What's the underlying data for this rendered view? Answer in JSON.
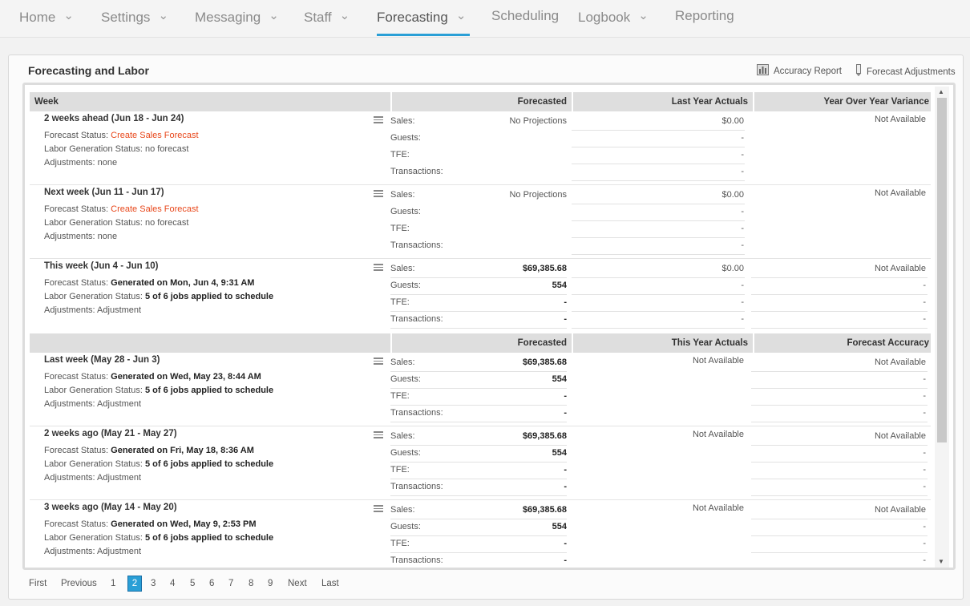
{
  "nav": {
    "items": [
      {
        "label": "Home",
        "chevron": true
      },
      {
        "label": "Settings",
        "chevron": true
      },
      {
        "label": "Messaging",
        "chevron": true
      },
      {
        "label": "Staff",
        "chevron": true
      },
      {
        "label": "Forecasting",
        "chevron": true,
        "active": true
      },
      {
        "label": "Scheduling",
        "chevron": false
      },
      {
        "label": "Logbook",
        "chevron": true
      },
      {
        "label": "Reporting",
        "chevron": false
      }
    ],
    "accent_color": "#2a9fd6"
  },
  "panel": {
    "title": "Forecasting and Labor",
    "accuracy_report": "Accuracy Report",
    "forecast_adjustments": "Forecast Adjustments"
  },
  "future_header": {
    "week": "Week",
    "forecasted": "Forecasted",
    "last_year_actuals": "Last Year Actuals",
    "yoy_variance": "Year Over Year Variance"
  },
  "past_header": {
    "forecasted": "Forecasted",
    "this_year_actuals": "This Year Actuals",
    "forecast_accuracy": "Forecast Accuracy"
  },
  "labels": {
    "forecast_status": "Forecast Status: ",
    "labor_status": "Labor Generation Status: ",
    "adjustments": "Adjustments: ",
    "sales": "Sales:",
    "guests": "Guests:",
    "tfe": "TFE:",
    "transactions": "Transactions:"
  },
  "weeks": [
    {
      "title": "2 weeks ahead (Jun 18 - Jun 24)",
      "forecast_status": "Create Sales Forecast",
      "forecast_link": true,
      "labor_status": "no forecast",
      "labor_bold": false,
      "adjustments": "none",
      "forecasted": [
        "No Projections",
        "",
        "",
        ""
      ],
      "forecasted_bold": false,
      "col3": [
        "$0.00",
        "-",
        "-",
        "-"
      ],
      "col4": [
        "Not Available"
      ]
    },
    {
      "title": "Next week (Jun 11 - Jun 17)",
      "forecast_status": "Create Sales Forecast",
      "forecast_link": true,
      "labor_status": "no forecast",
      "labor_bold": false,
      "adjustments": "none",
      "forecasted": [
        "No Projections",
        "",
        "",
        ""
      ],
      "forecasted_bold": false,
      "col3": [
        "$0.00",
        "-",
        "-",
        "-"
      ],
      "col4": [
        "Not Available"
      ]
    },
    {
      "title": "This week (Jun 4 - Jun 10)",
      "forecast_status": "Generated on Mon, Jun 4, 9:31 AM",
      "forecast_link": false,
      "labor_status": "5 of 6 jobs applied to schedule",
      "labor_bold": true,
      "adjustments": "Adjustment",
      "forecasted": [
        "$69,385.68",
        "554",
        "-",
        "-"
      ],
      "forecasted_bold": true,
      "col3": [
        "$0.00",
        "-",
        "-",
        "-"
      ],
      "col4": [
        "Not Available",
        "-",
        "-",
        "-"
      ]
    },
    {
      "title": "Last week (May 28 - Jun 3)",
      "forecast_status": "Generated on Wed, May 23, 8:44 AM",
      "forecast_link": false,
      "labor_status": "5 of 6 jobs applied to schedule",
      "labor_bold": true,
      "adjustments": "Adjustment",
      "forecasted": [
        "$69,385.68",
        "554",
        "-",
        "-"
      ],
      "forecasted_bold": true,
      "col3": [
        "Not Available"
      ],
      "col4": [
        "Not Available",
        "-",
        "-",
        "-"
      ]
    },
    {
      "title": "2 weeks ago (May 21 - May 27)",
      "forecast_status": "Generated on Fri, May 18, 8:36 AM",
      "forecast_link": false,
      "labor_status": "5 of 6 jobs applied to schedule",
      "labor_bold": true,
      "adjustments": "Adjustment",
      "forecasted": [
        "$69,385.68",
        "554",
        "-",
        "-"
      ],
      "forecasted_bold": true,
      "col3": [
        "Not Available"
      ],
      "col4": [
        "Not Available",
        "-",
        "-",
        "-"
      ]
    },
    {
      "title": "3 weeks ago (May 14 - May 20)",
      "forecast_status": "Generated on Wed, May 9, 2:53 PM",
      "forecast_link": false,
      "labor_status": "5 of 6 jobs applied to schedule",
      "labor_bold": true,
      "adjustments": "Adjustment",
      "forecasted": [
        "$69,385.68",
        "554",
        "-",
        "-"
      ],
      "forecasted_bold": true,
      "col3": [
        "Not Available"
      ],
      "col4": [
        "Not Available",
        "-",
        "-",
        "-"
      ]
    }
  ],
  "pagination": {
    "first": "First",
    "previous": "Previous",
    "pages": [
      "1",
      "2",
      "3",
      "4",
      "5",
      "6",
      "7",
      "8",
      "9"
    ],
    "current": "2",
    "next": "Next",
    "last": "Last"
  }
}
